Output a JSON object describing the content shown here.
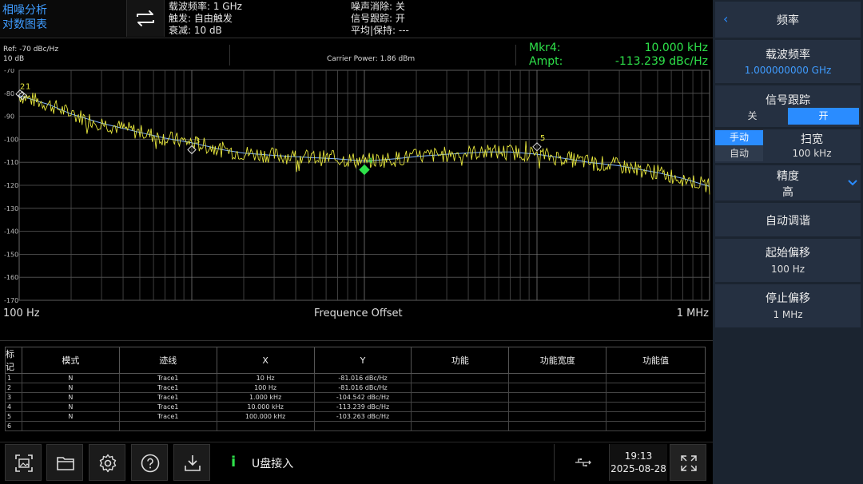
{
  "app": {
    "mode_title_line1": "相噪分析",
    "mode_title_line2": "对数图表"
  },
  "header": {
    "carrier_freq": "载波频率: 1 GHz",
    "trigger": "触发: 自由触发",
    "attenuation": "衰减: 10 dB",
    "noise_cancel": "噪声消除: 关",
    "signal_track": "信号跟踪: 开",
    "avg_hold": "平均|保持: ---"
  },
  "trace_header": {
    "ref": "Ref: -70 dBc/Hz",
    "scale": "10 dB",
    "carrier_power": "Carrier Power: 1.86 dBm",
    "mkr_label": "Mkr4:",
    "mkr_value": "10.000 kHz",
    "ampt_label": "Ampt:",
    "ampt_value": "-113.239 dBc/Hz"
  },
  "chart_data": {
    "type": "line",
    "x_scale": "log",
    "xlim": [
      100,
      1000000
    ],
    "ylim": [
      -170,
      -70
    ],
    "y_ticks": [
      "-70",
      "-80",
      "-90",
      "-100",
      "-110",
      "-120",
      "-130",
      "-140",
      "-150",
      "-160",
      "-170"
    ],
    "x_start_label": "100 Hz",
    "x_end_label": "1 MHz",
    "xlabel": "Frequence Offset",
    "grid": true,
    "trace_color": "#e6e63c",
    "smooth_color": "#7fb3ff",
    "series": [
      {
        "name": "Trace1",
        "x": [
          100,
          150,
          200,
          300,
          500,
          700,
          1000,
          1500,
          2000,
          3000,
          5000,
          7000,
          10000,
          15000,
          20000,
          30000,
          50000,
          70000,
          100000,
          150000,
          200000,
          300000,
          500000,
          700000,
          1000000
        ],
        "y": [
          -81,
          -85,
          -89,
          -93,
          -97,
          -99.5,
          -101.5,
          -104.5,
          -106,
          -107,
          -108,
          -108.5,
          -109.5,
          -108.5,
          -107.5,
          -106.5,
          -105.5,
          -105.5,
          -106.5,
          -108.5,
          -110,
          -111.5,
          -114.5,
          -117,
          -120.5
        ]
      }
    ],
    "markers": [
      {
        "label": "1",
        "x": 100,
        "y": -81.016,
        "shape": "diamond-outline"
      },
      {
        "label": "2",
        "x": 100,
        "y": -81.016,
        "shape": "diamond-outline"
      },
      {
        "label": "3",
        "x": 1000,
        "y": -104.542,
        "shape": "diamond-outline"
      },
      {
        "label": "4",
        "x": 10000,
        "y": -113.239,
        "shape": "diamond-filled",
        "active": true
      },
      {
        "label": "5",
        "x": 100000,
        "y": -103.263,
        "shape": "diamond-outline"
      }
    ]
  },
  "marker_table": {
    "headers": [
      "标记",
      "模式",
      "迹线",
      "X",
      "Y",
      "功能",
      "功能宽度",
      "功能值"
    ],
    "rows": [
      [
        "1",
        "N",
        "Trace1",
        "10 Hz",
        "-81.016 dBc/Hz",
        "",
        "",
        ""
      ],
      [
        "2",
        "N",
        "Trace1",
        "100 Hz",
        "-81.016 dBc/Hz",
        "",
        "",
        ""
      ],
      [
        "3",
        "N",
        "Trace1",
        "1.000 kHz",
        "-104.542 dBc/Hz",
        "",
        "",
        ""
      ],
      [
        "4",
        "N",
        "Trace1",
        "10.000 kHz",
        "-113.239 dBc/Hz",
        "",
        "",
        ""
      ],
      [
        "5",
        "N",
        "Trace1",
        "100.000 kHz",
        "-103.263 dBc/Hz",
        "",
        "",
        ""
      ],
      [
        "6",
        "",
        "",
        "",
        "",
        "",
        "",
        ""
      ]
    ]
  },
  "bottom_bar": {
    "buttons": [
      "screenshot-icon",
      "folder-icon",
      "gear-icon",
      "help-icon",
      "download-icon"
    ],
    "status_icon": "i",
    "status_text": "U盘接入",
    "usb_icon": "usb-icon",
    "time": "19:13",
    "date": "2025-08-28",
    "fullscreen_icon": "fullscreen-icon"
  },
  "right_panel": {
    "title": "频率",
    "carrier_freq_label": "载波频率",
    "carrier_freq_value": "1.000000000 GHz",
    "signal_track_label": "信号跟踪",
    "signal_track_off": "关",
    "signal_track_on": "开",
    "manual": "手动",
    "auto": "自动",
    "span_label": "扫宽",
    "span_value": "100 kHz",
    "precision_label": "精度",
    "precision_value": "高",
    "auto_tune": "自动调谐",
    "start_offset_label": "起始偏移",
    "start_offset_value": "100 Hz",
    "stop_offset_label": "停止偏移",
    "stop_offset_value": "1 MHz",
    "accent": "#2a8cff"
  }
}
